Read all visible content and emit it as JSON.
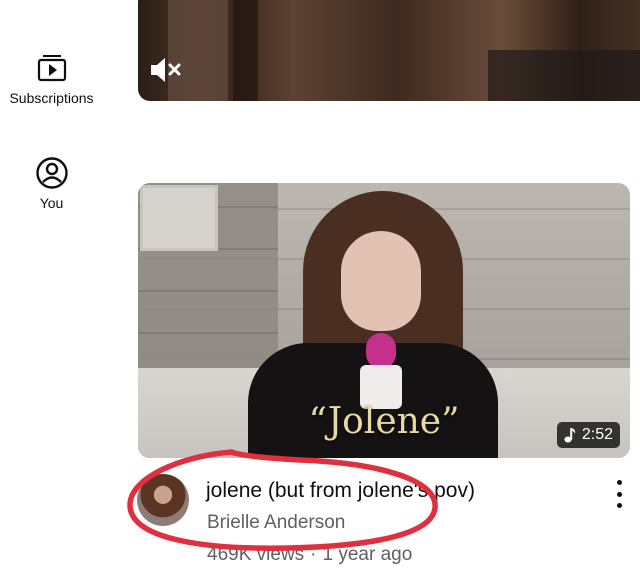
{
  "nav": {
    "subscriptions_label": "Subscriptions",
    "you_label": "You"
  },
  "top_video": {
    "mute_icon": "muted-speaker-icon"
  },
  "video": {
    "caption_overlay": "“Jolene”",
    "duration": "2:52",
    "duration_icon": "music-note-icon",
    "title": "jolene (but from jolene's pov)",
    "channel": "Brielle Anderson",
    "views": "469K views",
    "separator": "·",
    "age": "1 year ago"
  },
  "colors": {
    "annotation": "#e0303f",
    "text_primary": "#0f0f0f",
    "text_secondary": "#606060"
  }
}
